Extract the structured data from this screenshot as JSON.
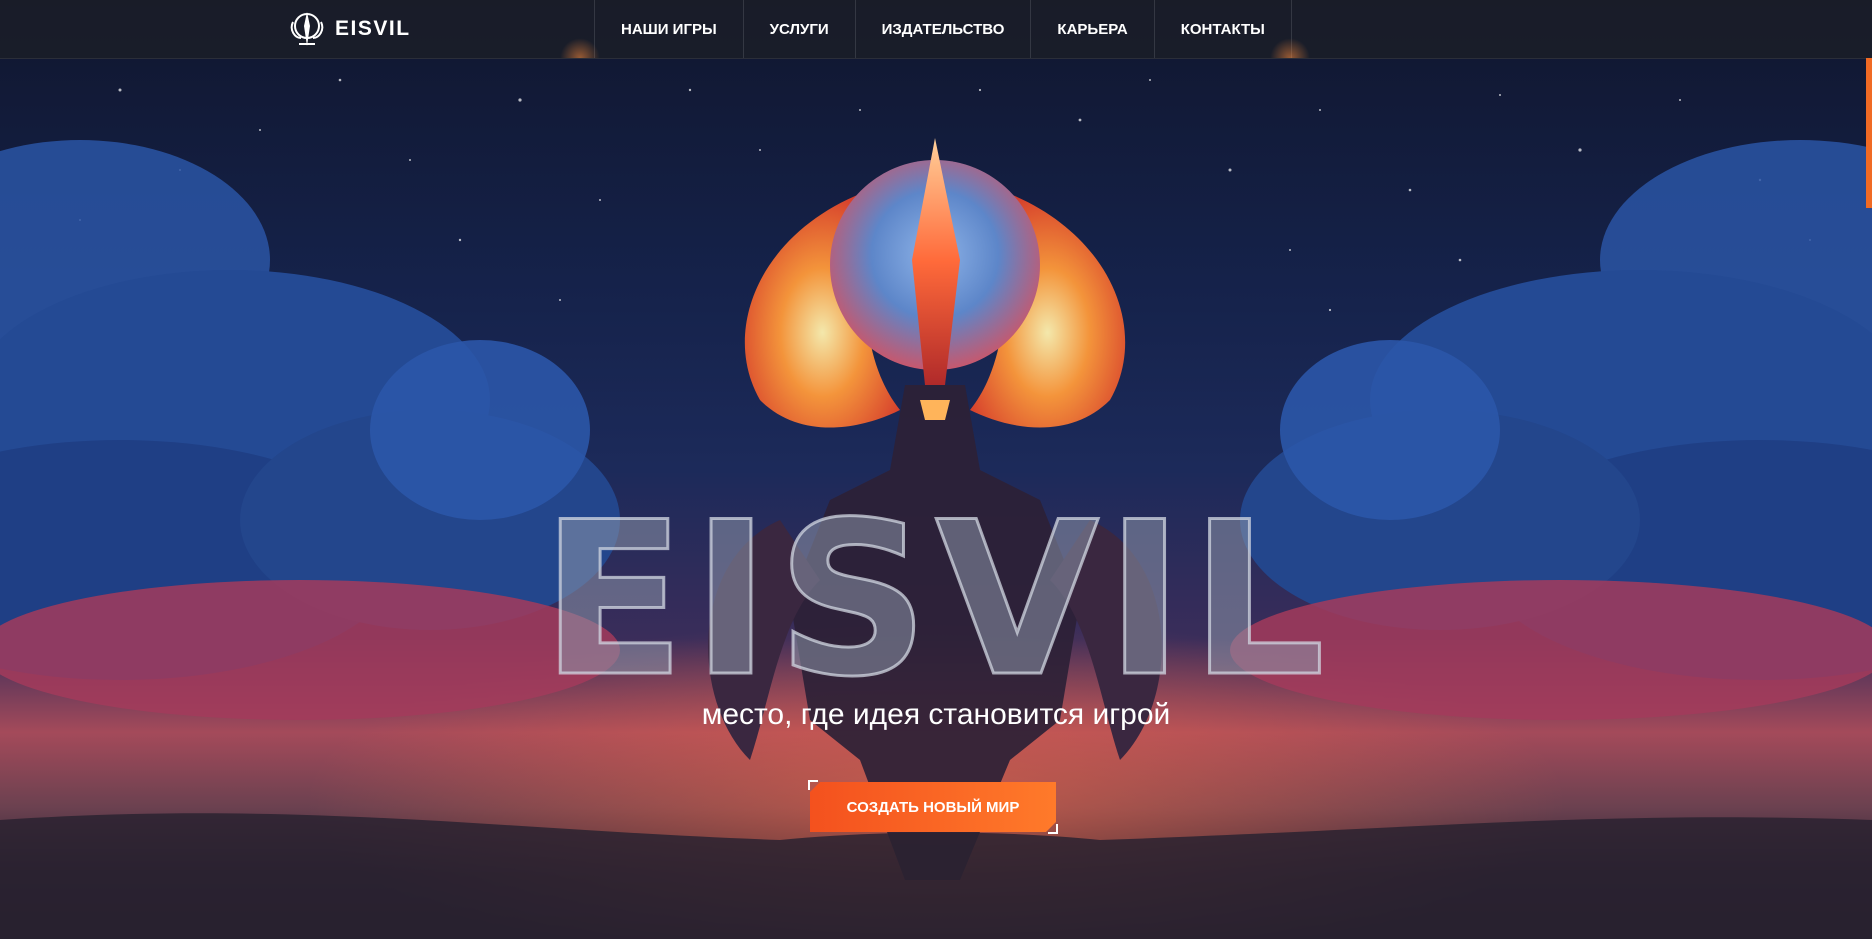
{
  "brand": {
    "name": "EISVIL"
  },
  "nav": {
    "items": [
      {
        "label": "НАШИ ИГРЫ"
      },
      {
        "label": "УСЛУГИ"
      },
      {
        "label": "ИЗДАТЕЛЬСТВО"
      },
      {
        "label": "КАРЬЕРА"
      },
      {
        "label": "КОНТАКТЫ"
      }
    ]
  },
  "hero": {
    "title": "EISVIL",
    "subtitle": "место, где идея становится игрой",
    "cta_label": "СОЗДАТЬ НОВЫЙ МИР"
  },
  "colors": {
    "accent": "#f4511e",
    "accent_light": "#ff7a2a",
    "nav_bg": "#1a1d29",
    "text": "#ffffff"
  }
}
